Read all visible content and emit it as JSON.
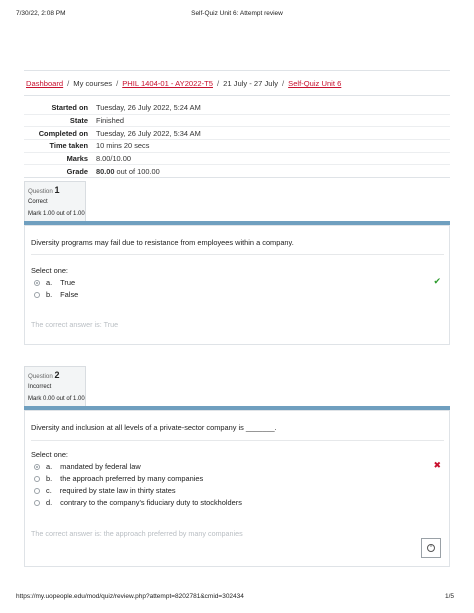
{
  "print_header": {
    "datetime": "7/30/22, 2:08 PM",
    "title": "Self-Quiz Unit 6: Attempt review"
  },
  "breadcrumb": {
    "items": [
      {
        "label": "Dashboard",
        "link": true
      },
      {
        "label": "My courses",
        "link": false
      },
      {
        "label": "PHIL 1404-01 - AY2022-T5",
        "link": true
      },
      {
        "label": "21 July - 27 July",
        "link": false
      },
      {
        "label": "Self-Quiz Unit 6",
        "link": true
      }
    ],
    "separator": "/"
  },
  "summary": [
    {
      "label": "Started on",
      "value": "Tuesday, 26 July 2022, 5:24 AM"
    },
    {
      "label": "State",
      "value": "Finished"
    },
    {
      "label": "Completed on",
      "value": "Tuesday, 26 July 2022, 5:34 AM"
    },
    {
      "label": "Time taken",
      "value": "10 mins 20 secs"
    },
    {
      "label": "Marks",
      "value": "8.00/10.00"
    },
    {
      "label": "Grade",
      "value_bold": "80.00",
      "value_rest": " out of 100.00"
    }
  ],
  "questions": [
    {
      "prefix": "Question",
      "number": "1",
      "state": "Correct",
      "mark": "Mark 1.00 out of 1.00",
      "text": "Diversity programs may fail due to resistance from employees within a company.",
      "prompt": "Select one:",
      "options": [
        {
          "letter": "a.",
          "label": "True",
          "checked": true
        },
        {
          "letter": "b.",
          "label": "False",
          "checked": false
        }
      ],
      "mark_icon": "✔",
      "feedback": "The correct answer is: True"
    },
    {
      "prefix": "Question",
      "number": "2",
      "state": "Incorrect",
      "mark": "Mark 0.00 out of 1.00",
      "text": "Diversity and inclusion at all levels of a private-sector company is _______.",
      "prompt": "Select one:",
      "options": [
        {
          "letter": "a.",
          "label": "mandated by federal law",
          "checked": true
        },
        {
          "letter": "b.",
          "label": "the approach preferred by many companies",
          "checked": false
        },
        {
          "letter": "c.",
          "label": "required by state law in thirty states",
          "checked": false
        },
        {
          "letter": "d.",
          "label": "contrary to the company's fiduciary duty to stockholders",
          "checked": false
        }
      ],
      "mark_icon": "✖",
      "feedback": "The correct answer is: the approach preferred by many companies"
    }
  ],
  "scroll_top_icon": "^",
  "print_footer": {
    "url": "https://my.uopeople.edu/mod/quiz/review.php?attempt=8202781&cmid=302434",
    "page": "1/5"
  },
  "colors": {
    "link": "#c8102e",
    "bar": "#6f9fbf",
    "correct": "#2c9b2c",
    "incorrect": "#c8102e"
  }
}
